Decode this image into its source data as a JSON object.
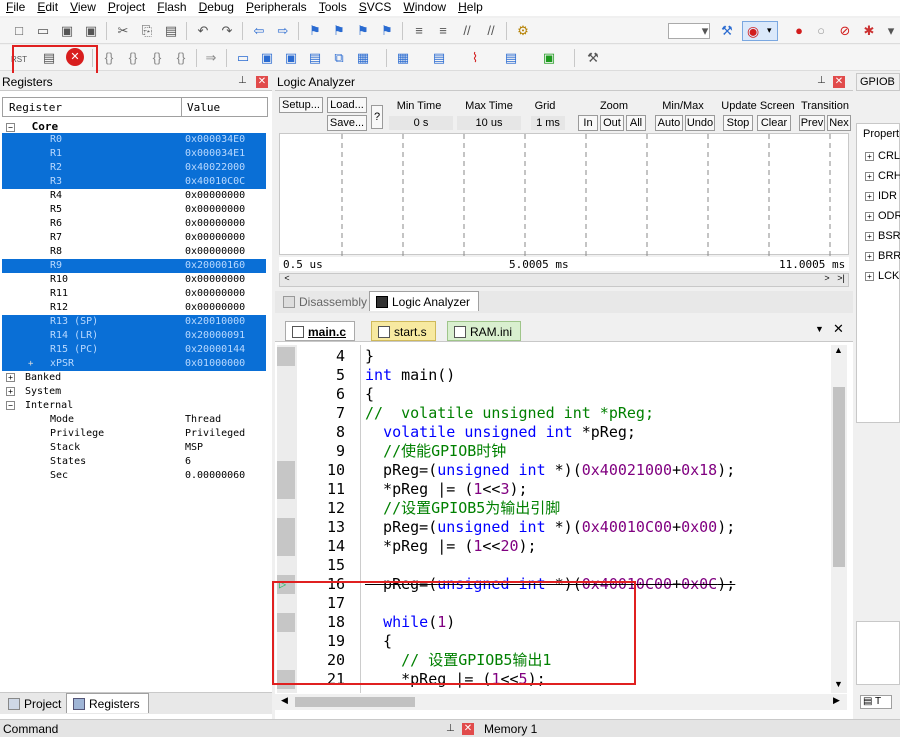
{
  "menu": [
    "File",
    "Edit",
    "View",
    "Project",
    "Flash",
    "Debug",
    "Peripherals",
    "Tools",
    "SVCS",
    "Window",
    "Help"
  ],
  "toolbar2": {
    "rst_label": "RST"
  },
  "registers": {
    "title": "Registers",
    "col_register": "Register",
    "col_value": "Value",
    "core_label": "Core",
    "rows": [
      {
        "name": "R0",
        "value": "0x000034E0",
        "selected": true
      },
      {
        "name": "R1",
        "value": "0x000034E1",
        "selected": true
      },
      {
        "name": "R2",
        "value": "0x40022000",
        "selected": true
      },
      {
        "name": "R3",
        "value": "0x40010C0C",
        "selected": true
      },
      {
        "name": "R4",
        "value": "0x00000000",
        "selected": false
      },
      {
        "name": "R5",
        "value": "0x00000000",
        "selected": false
      },
      {
        "name": "R6",
        "value": "0x00000000",
        "selected": false
      },
      {
        "name": "R7",
        "value": "0x00000000",
        "selected": false
      },
      {
        "name": "R8",
        "value": "0x00000000",
        "selected": false
      },
      {
        "name": "R9",
        "value": "0x20000160",
        "selected": true
      },
      {
        "name": "R10",
        "value": "0x00000000",
        "selected": false
      },
      {
        "name": "R11",
        "value": "0x00000000",
        "selected": false
      },
      {
        "name": "R12",
        "value": "0x00000000",
        "selected": false
      },
      {
        "name": "R13 (SP)",
        "value": "0x20010000",
        "selected": true
      },
      {
        "name": "R14 (LR)",
        "value": "0x20000091",
        "selected": true
      },
      {
        "name": "R15 (PC)",
        "value": "0x20000144",
        "selected": true
      },
      {
        "name": "xPSR",
        "value": "0x01000000",
        "selected": true
      }
    ],
    "groups": [
      "Banked",
      "System",
      "Internal"
    ],
    "internal": [
      {
        "name": "Mode",
        "value": "Thread"
      },
      {
        "name": "Privilege",
        "value": "Privileged"
      },
      {
        "name": "Stack",
        "value": "MSP"
      },
      {
        "name": "States",
        "value": "6"
      },
      {
        "name": "Sec",
        "value": "0.00000060"
      }
    ],
    "tab_project": "Project",
    "tab_registers": "Registers"
  },
  "logic": {
    "title": "Logic Analyzer",
    "setup": "Setup...",
    "load": "Load...",
    "save": "Save...",
    "help": "?",
    "min_time_label": "Min Time",
    "min_time": "0 s",
    "max_time_label": "Max Time",
    "max_time": "10 us",
    "grid_label": "Grid",
    "grid": "1 ms",
    "zoom_label": "Zoom",
    "zoom_btns": [
      "In",
      "Out",
      "All"
    ],
    "minmax_label": "Min/Max",
    "minmax_btns": [
      "Auto",
      "Undo"
    ],
    "update_label": "Update Screen",
    "update_btns": [
      "Stop",
      "Clear"
    ],
    "trans_label": "Transition",
    "trans_btns": [
      "Prev",
      "Nex"
    ],
    "axis_left": "0.5 us",
    "axis_mid": "5.0005 ms",
    "axis_right": "11.0005 ms",
    "tab_disasm": "Disassembly",
    "tab_logic": "Logic Analyzer"
  },
  "editor": {
    "tabs": [
      "main.c",
      "start.s",
      "RAM.ini"
    ],
    "lines": [
      {
        "n": "4",
        "mark": true,
        "html": "<span>}</span>"
      },
      {
        "n": "5",
        "mark": false,
        "html": "<span class='kw'>int</span> main()"
      },
      {
        "n": "6",
        "mark": false,
        "html": "{"
      },
      {
        "n": "7",
        "mark": false,
        "html": "<span class='cmt'>//  volatile unsigned int *pReg;</span>"
      },
      {
        "n": "8",
        "mark": false,
        "html": "  <span class='kw'>volatile unsigned int</span> *pReg;"
      },
      {
        "n": "9",
        "mark": false,
        "html": "  <span class='cmt'>//使能GPIOB时钟</span>"
      },
      {
        "n": "10",
        "mark": true,
        "html": "  pReg=(<span class='kw'>unsigned int</span> *)(<span class='num'>0x40021000</span>+<span class='num'>0x18</span>);"
      },
      {
        "n": "11",
        "mark": true,
        "html": "  *pReg |= (<span class='num'>1</span>&lt;&lt;<span class='num'>3</span>);"
      },
      {
        "n": "12",
        "mark": false,
        "html": "  <span class='cmt'>//设置GPIOB5为输出引脚</span>"
      },
      {
        "n": "13",
        "mark": true,
        "html": "  pReg=(<span class='kw'>unsigned int</span> *)(<span class='num'>0x40010C00</span>+<span class='num'>0x00</span>);"
      },
      {
        "n": "14",
        "mark": true,
        "html": "  *pReg |= (<span class='num'>1</span>&lt;&lt;<span class='num'>20</span>);"
      },
      {
        "n": "15",
        "mark": false,
        "html": ""
      },
      {
        "n": "16",
        "mark": true,
        "html": "  pReg=(<span class='kw'>unsigned int</span> *)(<span class='num'>0x40010C00</span>+<span class='num'>0x0C</span>);"
      },
      {
        "n": "17",
        "mark": false,
        "html": ""
      },
      {
        "n": "18",
        "mark": true,
        "html": "  <span class='kw'>while</span>(<span class='num'>1</span>)"
      },
      {
        "n": "19",
        "mark": false,
        "html": "  {"
      },
      {
        "n": "20",
        "mark": false,
        "html": "    <span class='cmt'>// 设置GPIOB5输出1</span>"
      },
      {
        "n": "21",
        "mark": true,
        "html": "    *pReg |= (<span class='num'>1</span>&lt;&lt;<span class='num'>5</span>);"
      }
    ]
  },
  "gpiob": {
    "title": "GPIOB",
    "prop_label": "Propert",
    "items": [
      "CRL",
      "CRH",
      "IDR",
      "ODR",
      "BSR",
      "BRR",
      "LCK"
    ]
  },
  "bottom": {
    "command": "Command",
    "memory": "Memory 1"
  },
  "colors": {
    "selection": "#0a6fd6",
    "highlight_box": "#e02020",
    "keyword": "#0000ff",
    "comment": "#008000",
    "number": "#800080"
  }
}
